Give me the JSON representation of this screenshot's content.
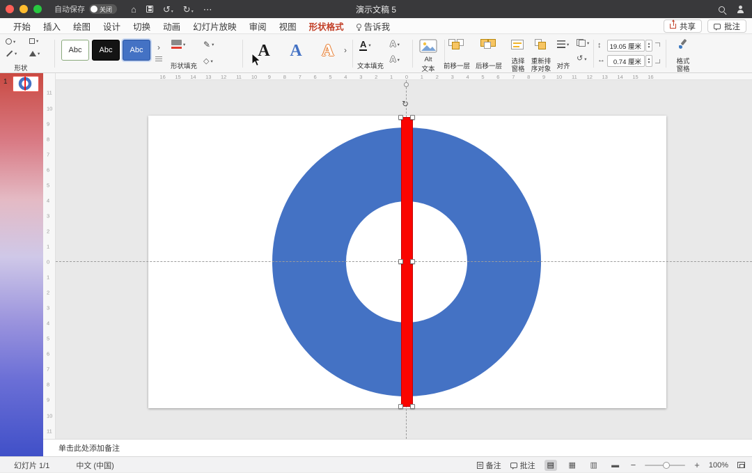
{
  "titlebar": {
    "title": "演示文稿 5",
    "autosave_label": "自动保存",
    "autosave_state": "关闭"
  },
  "tabs": [
    {
      "id": "home",
      "label": "开始"
    },
    {
      "id": "insert",
      "label": "插入"
    },
    {
      "id": "draw",
      "label": "绘图"
    },
    {
      "id": "design",
      "label": "设计"
    },
    {
      "id": "transitions",
      "label": "切换"
    },
    {
      "id": "animations",
      "label": "动画"
    },
    {
      "id": "slideshow",
      "label": "幻灯片放映"
    },
    {
      "id": "review",
      "label": "审阅"
    },
    {
      "id": "view",
      "label": "视图"
    },
    {
      "id": "shape-format",
      "label": "形状格式",
      "active": true
    },
    {
      "id": "tell-me",
      "label": "告诉我",
      "bulb": true
    }
  ],
  "top_actions": {
    "share": "共享",
    "comments": "批注"
  },
  "ribbon": {
    "shapes_label": "形状",
    "style_cards": [
      "Abc",
      "Abc",
      "Abc"
    ],
    "shape_fill_label": "形状填充",
    "text_style_letter": "A",
    "text_fill_label": "文本填充",
    "alt_text_line1": "Alt",
    "alt_text_line2": "文本",
    "bring_forward": "前移一层",
    "send_backward": "后移一层",
    "selection_pane_line1": "选择",
    "selection_pane_line2": "窗格",
    "reorder_line1": "重新排",
    "reorder_line2": "序对象",
    "align_label": "对齐",
    "height_value": "19.05 厘米",
    "width_value": "0.74 厘米",
    "format_pane_line1": "格式",
    "format_pane_line2": "窗格"
  },
  "slides_panel": {
    "slide_number": "1"
  },
  "rulers": {
    "horizontal": [
      "16",
      "15",
      "14",
      "13",
      "12",
      "11",
      "10",
      "9",
      "8",
      "7",
      "6",
      "5",
      "4",
      "3",
      "2",
      "1",
      "0",
      "1",
      "2",
      "3",
      "4",
      "5",
      "6",
      "7",
      "8",
      "9",
      "10",
      "11",
      "12",
      "13",
      "14",
      "15",
      "16"
    ],
    "vertical": [
      "11",
      "10",
      "9",
      "8",
      "7",
      "6",
      "5",
      "4",
      "3",
      "2",
      "1",
      "0",
      "1",
      "2",
      "3",
      "4",
      "5",
      "6",
      "7",
      "8",
      "9",
      "10",
      "11"
    ]
  },
  "notes": {
    "placeholder": "单击此处添加备注"
  },
  "statusbar": {
    "slide_counter": "幻灯片 1/1",
    "language": "中文 (中国)",
    "notes_label": "备注",
    "comments_label": "批注",
    "zoom_level": "100%"
  },
  "canvas": {
    "ring_color": "#4472C4",
    "bar_color": "#FA0500",
    "tab_accent": "#C23F27"
  }
}
